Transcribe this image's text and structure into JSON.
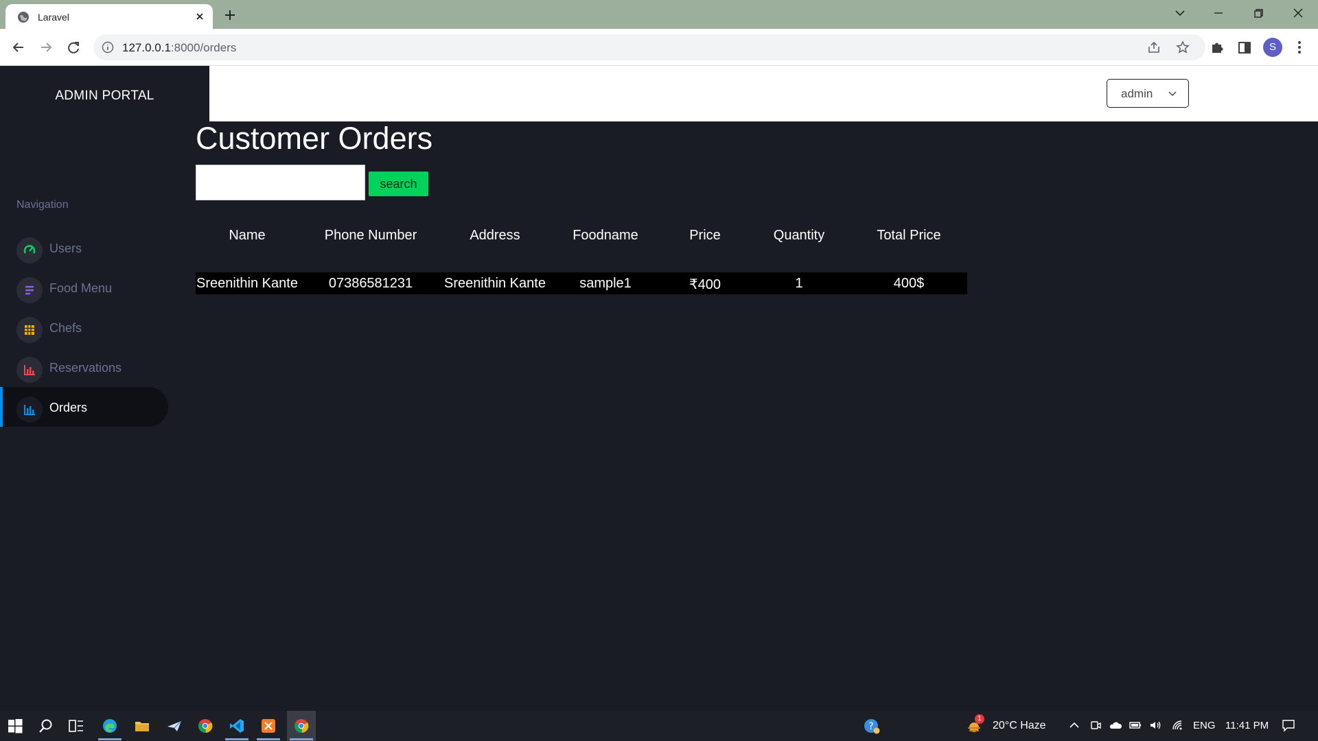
{
  "browser": {
    "tab_title": "Laravel",
    "url_host": "127.0.0.1",
    "url_rest": ":8000/orders",
    "profile_initial": "S"
  },
  "app": {
    "brand": "ADMIN PORTAL",
    "user_menu_label": "admin",
    "page_title": "Customer Orders",
    "search": {
      "value": "",
      "button_label": "search"
    }
  },
  "sidebar": {
    "heading": "Navigation",
    "items": [
      {
        "label": "Users",
        "icon": "speedometer-icon",
        "icon_color": "#00d25b"
      },
      {
        "label": "Food Menu",
        "icon": "menu-lines-icon",
        "icon_color": "#8f5fe8"
      },
      {
        "label": "Chefs",
        "icon": "table-grid-icon",
        "icon_color": "#ffab00"
      },
      {
        "label": "Reservations",
        "icon": "bar-chart-icon",
        "icon_color": "#fc424a"
      },
      {
        "label": "Orders",
        "icon": "bar-chart-icon",
        "icon_color": "#0090e7",
        "active": true
      }
    ]
  },
  "orders_table": {
    "columns": [
      "Name",
      "Phone Number",
      "Address",
      "Foodname",
      "Price",
      "Quantity",
      "Total Price"
    ],
    "rows": [
      [
        "Sreenithin Kante",
        "07386581231",
        "Sreenithin Kante",
        "sample1",
        "₹400",
        "1",
        "400$"
      ]
    ]
  },
  "taskbar": {
    "weather": "20°C  Haze",
    "language": "ENG",
    "clock": "11:41 PM",
    "weather_badge": "1"
  },
  "colors": {
    "background": "#191c24",
    "accent_green": "#00d25b",
    "active_blue": "#0090e7",
    "chrome_frame": "#9cae9c"
  }
}
